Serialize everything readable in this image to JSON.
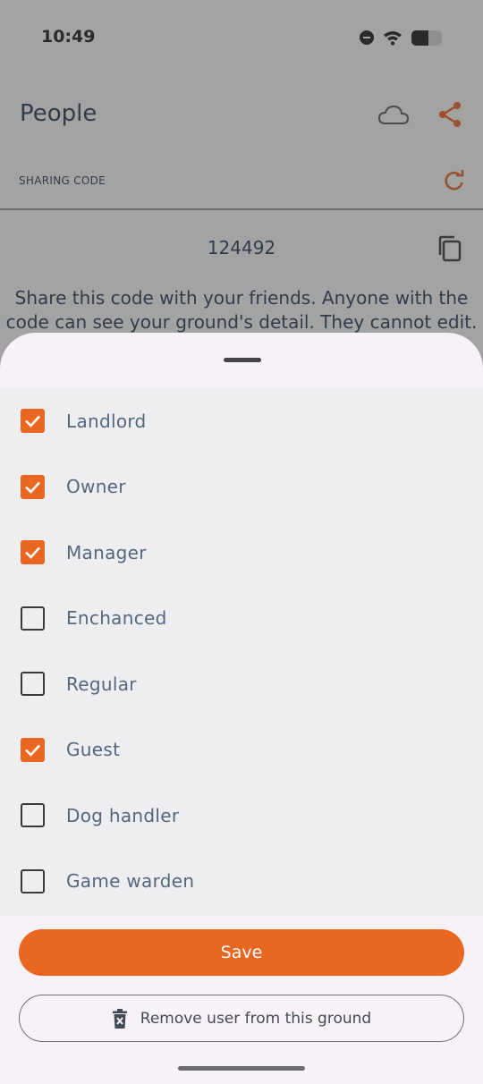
{
  "status_bar": {
    "time": "10:49",
    "battery_level": 0.55
  },
  "header": {
    "title": "People",
    "cloud_icon": "cloud-icon",
    "share_icon": "share-icon"
  },
  "sharing": {
    "label": "SHARING CODE",
    "code": "124492",
    "description": "Share this code with your friends. Anyone with the code can see your ground's detail. They cannot edit."
  },
  "roles": [
    {
      "label": "Landlord",
      "checked": true
    },
    {
      "label": "Owner",
      "checked": true
    },
    {
      "label": "Manager",
      "checked": true
    },
    {
      "label": "Enchanced",
      "checked": false
    },
    {
      "label": "Regular",
      "checked": false
    },
    {
      "label": "Guest",
      "checked": true
    },
    {
      "label": "Dog handler",
      "checked": false
    },
    {
      "label": "Game warden",
      "checked": false
    }
  ],
  "actions": {
    "save_label": "Save",
    "remove_label": "Remove user from this ground"
  },
  "colors": {
    "accent": "#ea6722",
    "text": "#2b3d55"
  }
}
